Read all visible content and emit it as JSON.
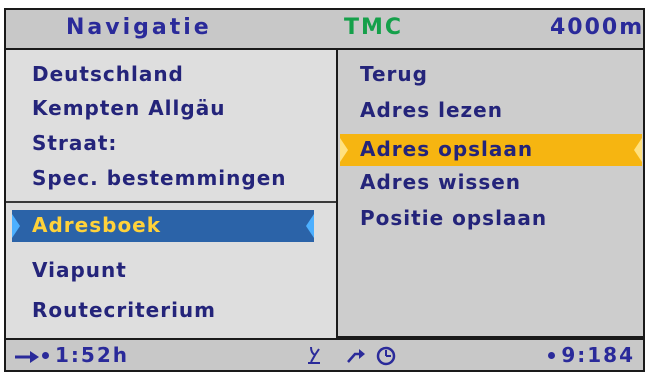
{
  "header": {
    "title": "Navigatie",
    "tmc": "TMC",
    "distance": "4000m"
  },
  "left_menu": {
    "items": [
      "Deutschland",
      "Kempten Allgäu",
      "Straat:",
      "Spec. bestemmingen"
    ],
    "selected": "Adresboek",
    "lower_items": [
      "Viapunt",
      "Routecriterium"
    ]
  },
  "right_menu": {
    "items": [
      "Terug",
      "Adres lezen"
    ],
    "selected": "Adres opslaan",
    "lower_items": [
      "Adres wissen",
      "Positie opslaan"
    ]
  },
  "footer": {
    "eta": "1:52h",
    "clock": "9:184"
  },
  "colors": {
    "text": "#24247a",
    "tmc": "#15a04a",
    "left_highlight": "#2b63a8",
    "left_highlight_text": "#ffd23a",
    "right_highlight": "#f6b511"
  },
  "icons": [
    "arrow-right-icon",
    "pin-icon",
    "route-icon",
    "clock-icon"
  ]
}
